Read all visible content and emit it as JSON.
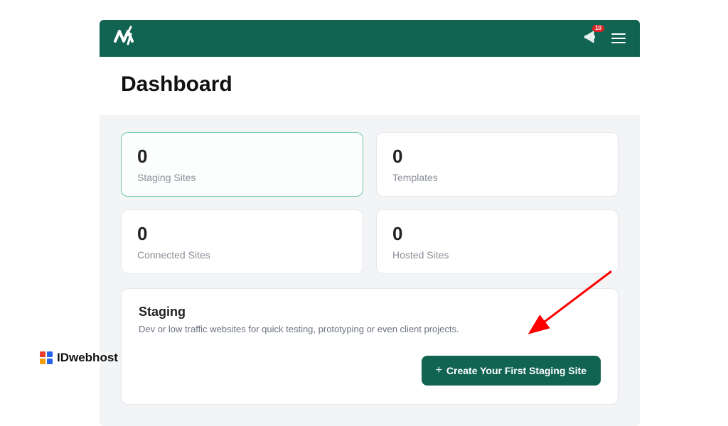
{
  "header": {
    "notification_count": "10"
  },
  "page": {
    "title": "Dashboard"
  },
  "stats": {
    "staging": {
      "value": "0",
      "label": "Staging Sites"
    },
    "templates": {
      "value": "0",
      "label": "Templates"
    },
    "connected": {
      "value": "0",
      "label": "Connected Sites"
    },
    "hosted": {
      "value": "0",
      "label": "Hosted Sites"
    }
  },
  "staging_section": {
    "title": "Staging",
    "description": "Dev or low traffic websites for quick testing, prototyping or even client projects.",
    "cta_label": "Create Your First Staging Site"
  },
  "watermark": {
    "label": "IDwebhost"
  }
}
